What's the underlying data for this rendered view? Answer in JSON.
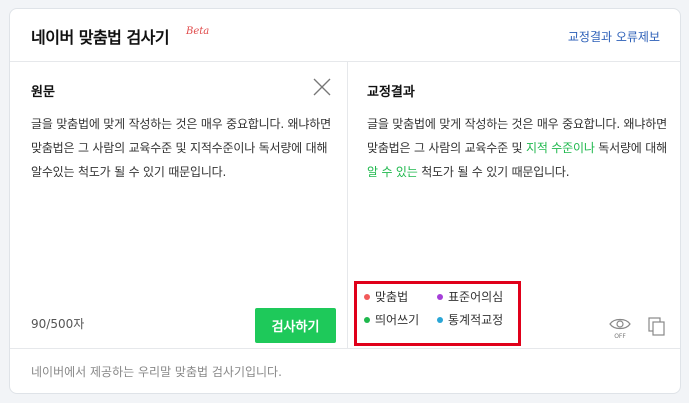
{
  "header": {
    "title": "네이버 맞춤법 검사기",
    "beta": "Beta",
    "report_link": "교정결과 오류제보"
  },
  "original": {
    "title": "원문",
    "text": "글을 맞춤법에 맞게 작성하는 것은 매우 중요합니다. 왜냐하면 맞춤법은 그 사람의 교육수준 및 지적수준이나 독서량에 대해 알수있는 척도가 될 수 있기 때문입니다.",
    "counter": "90/500자",
    "check_button": "검사하기",
    "close_icon": "close-icon"
  },
  "corrected": {
    "title": "교정결과",
    "segments": [
      {
        "text": "글을 맞춤법에 맞게 작성하는 것은 매우 중요합니다. 왜냐하면 맞춤법은 그 사람의 교육수준 및 ",
        "type": "normal"
      },
      {
        "text": "지적 수준이나",
        "type": "spacing"
      },
      {
        "text": " 독서량에 대해 ",
        "type": "normal"
      },
      {
        "text": "알 수 있는",
        "type": "spacing"
      },
      {
        "text": " 척도가 될 수 ",
        "type": "normal"
      },
      {
        "text": "있기",
        "type": "normal"
      },
      {
        "text": " 때문입니다.",
        "type": "normal"
      }
    ]
  },
  "legend": [
    {
      "label": "맞춤법",
      "color": "#f25a5a"
    },
    {
      "label": "표준어의심",
      "color": "#a53fd8"
    },
    {
      "label": "띄어쓰기",
      "color": "#1fb84d"
    },
    {
      "label": "통계적교정",
      "color": "#2aa6d6"
    }
  ],
  "tools": {
    "eye_label": "OFF",
    "eye_icon": "eye-icon",
    "copy_icon": "copy-icon"
  },
  "colors": {
    "accent_green": "#1ec95a",
    "link_blue": "#2c5fb8",
    "highlight_box": "#e0001a"
  },
  "footer": {
    "text": "네이버에서 제공하는 우리말 맞춤법 검사기입니다."
  }
}
